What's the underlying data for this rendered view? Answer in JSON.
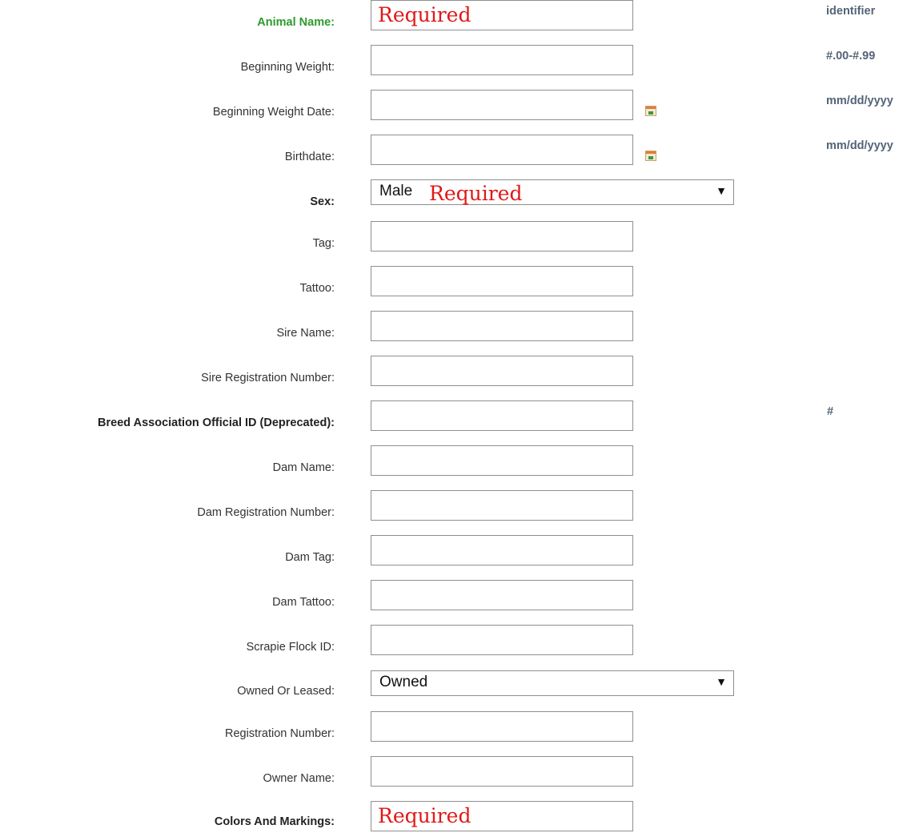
{
  "form": {
    "required_text": "Required",
    "fields": {
      "animal_name": {
        "label": "Animal Name:",
        "hint": "identifier"
      },
      "beginning_weight": {
        "label": "Beginning Weight:",
        "hint": "#.00-#.99"
      },
      "beginning_weight_date": {
        "label": "Beginning Weight Date:",
        "hint": "mm/dd/yyyy"
      },
      "birthdate": {
        "label": "Birthdate:",
        "hint": "mm/dd/yyyy"
      },
      "sex": {
        "label": "Sex:",
        "value": "Male"
      },
      "tag": {
        "label": "Tag:"
      },
      "tattoo": {
        "label": "Tattoo:"
      },
      "sire_name": {
        "label": "Sire Name:"
      },
      "sire_registration_number": {
        "label": "Sire Registration Number:"
      },
      "breed_association_official_id": {
        "label": "Breed Association Official ID (Deprecated):",
        "hint": "#"
      },
      "dam_name": {
        "label": "Dam Name:"
      },
      "dam_registration_number": {
        "label": "Dam Registration Number:"
      },
      "dam_tag": {
        "label": "Dam Tag:"
      },
      "dam_tattoo": {
        "label": "Dam Tattoo:"
      },
      "scrapie_flock_id": {
        "label": "Scrapie Flock ID:"
      },
      "owned_or_leased": {
        "label": "Owned Or Leased:",
        "value": "Owned"
      },
      "registration_number": {
        "label": "Registration Number:"
      },
      "owner_name": {
        "label": "Owner Name:"
      },
      "colors_and_markings": {
        "label": "Colors And Markings:"
      }
    }
  },
  "icons": {
    "calendar": "calendar-icon",
    "dropdown": "triangle-down-icon"
  },
  "colors": {
    "required": "#e01818",
    "label_highlight": "#2e9a2e",
    "hint": "#546478"
  }
}
